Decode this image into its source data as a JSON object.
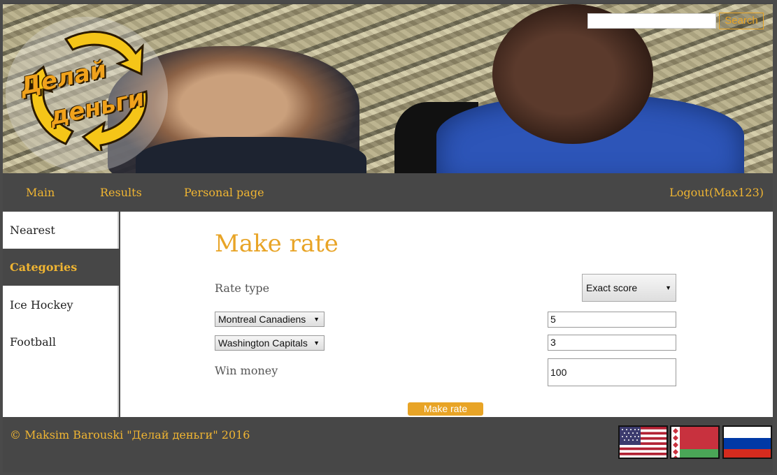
{
  "header": {
    "logo_line1": "Делай",
    "logo_line2": "деньги",
    "search": {
      "value": "",
      "placeholder": "",
      "button_label": "Search"
    }
  },
  "nav": {
    "main": "Main",
    "results": "Results",
    "personal_page": "Personal page",
    "logout": "Logout(Max123)"
  },
  "sidebar": {
    "items": [
      {
        "label": "Nearest",
        "active": false
      },
      {
        "label": "Categories",
        "active": true
      },
      {
        "label": "Ice Hockey",
        "active": false
      },
      {
        "label": "Football",
        "active": false
      }
    ]
  },
  "form": {
    "title": "Make rate",
    "rate_type_label": "Rate type",
    "rate_type_value": "Exact score",
    "team1": {
      "name": "Montreal Canadiens",
      "score": "5"
    },
    "team2": {
      "name": "Washington Capitals",
      "score": "3"
    },
    "win_money_label": "Win money",
    "win_money_value": "100",
    "submit_label": "Make rate"
  },
  "footer": {
    "copyright": "© Maksim Barouski \"Делай деньги\" 2016",
    "flags": [
      "us-flag-icon",
      "belarus-flag-icon",
      "russia-flag-icon"
    ]
  },
  "colors": {
    "accent": "#e8a426",
    "nav_text": "#f0b532",
    "dark_bg": "#474747"
  }
}
